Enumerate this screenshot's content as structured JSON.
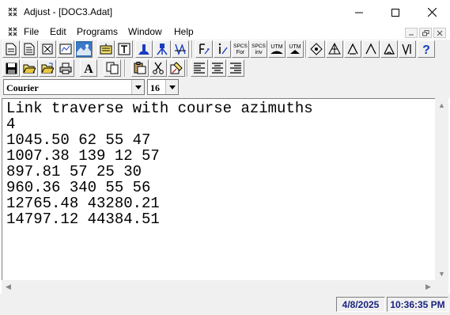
{
  "window": {
    "title": "Adjust - [DOC3.Adat]"
  },
  "menu": {
    "items": [
      "File",
      "Edit",
      "Programs",
      "Window",
      "Help"
    ]
  },
  "toolbar": {
    "row1_icons": [
      "new-document-icon",
      "new-document-alt-icon",
      "close-document-icon",
      "chart-icon",
      "image-icon",
      "text-block-icon",
      "text-frame-icon",
      "station-icon",
      "survey-tripod-icon",
      "leveling-icon",
      "formula-icon",
      "inverse-icon",
      "spcs-forward-icon",
      "spcs-inverse-icon",
      "utm-icon",
      "utm-alt-icon",
      "traverse-point-icon",
      "triangle-network-icon",
      "open-traverse-icon",
      "closed-triangle-icon",
      "angle-icon",
      "vertical-angle-icon",
      "help-icon"
    ],
    "row1_labels": {
      "spcs_for_top": "SPCS",
      "spcs_for_bottom": "For",
      "spcs_inv_top": "SPCS",
      "spcs_inv_bottom": "inv",
      "utm_a": "UTM",
      "utm_b": "UTM",
      "help": "?"
    },
    "row2_icons": [
      "save-icon",
      "open-folder-icon",
      "open-folder-alt-icon",
      "print-icon",
      "font-icon",
      "copy-document-icon",
      "paste-icon",
      "cut-icon",
      "highlight-icon",
      "align-left-icon",
      "align-center-icon",
      "align-right-icon"
    ],
    "font_label": "A",
    "font_family": "Courier",
    "font_size": "16"
  },
  "editor": {
    "lines": [
      "Link traverse with course azimuths",
      "4",
      "1045.50 62 55 47",
      "1007.38 139 12 57",
      "897.81 57 25 30",
      "960.36 340 55 56",
      "12765.48 43280.21",
      "14797.12 44384.51"
    ]
  },
  "status": {
    "date": "4/8/2025",
    "time": "10:36:35 PM"
  },
  "colors": {
    "status_text": "#1a237e",
    "pressed_button": "#2c6db3",
    "toolbar_bg": "#f0f0f0"
  }
}
